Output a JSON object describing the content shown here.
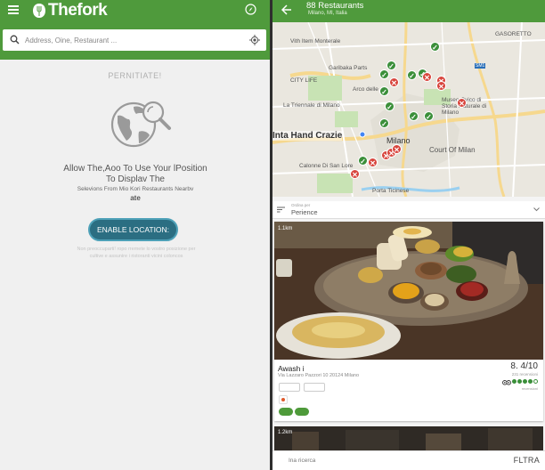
{
  "left": {
    "logo_text": "Thefork",
    "search_placeholder": "Address, Oine, Restaurant ...",
    "permission_title": "PERNITIATE!",
    "permission_line1": "Allow The,Aoo To Use Your lPosition To Displav The",
    "permission_line2": "Selevions From Mio Kori Restaurants Nearbv",
    "permission_line3": "ate",
    "enable_button": "ENABLE LOCATION:",
    "permission_note": "Non preoccuparti! ropo rremete lo vostro posizione per cultive e assunire i ristoranti vicini coloncos"
  },
  "right": {
    "results_count": "88 Restaurants",
    "results_location": "Milano, MI, Italia",
    "map_labels": {
      "item_monterale": "Vith Item Monterale",
      "garibaldi": "Garibaka Parts",
      "city_life": "CITY LIFE",
      "arco": "Arco delle",
      "triennale": "La Triennale di Milano",
      "museo": "Museo Cvico di Storia Naturale di Milano",
      "overlay": "Inta Hand Crazie",
      "milano": "Milano",
      "court": "Court Of Milan",
      "calonne": "Calonne Di San Lore",
      "porta": "Porta Ticinese",
      "gasorretto": "GASORETTO",
      "sm1": "SM1"
    },
    "sort_caption": "Ordina per",
    "sort_value": "Perience",
    "card": {
      "distance": "1.1km",
      "name": "Awash i",
      "address": "Via Lazzaro Pazzori 10 20124 Milano",
      "rating": "8. 4/10",
      "reviews": "231 recensioni",
      "ta_caption": "recensioni",
      "stars_filled": 4,
      "stars_total": 5
    },
    "card2_distance": "1.2km",
    "bottom_left": "Ina ricerca",
    "bottom_right": "FLTRA"
  }
}
